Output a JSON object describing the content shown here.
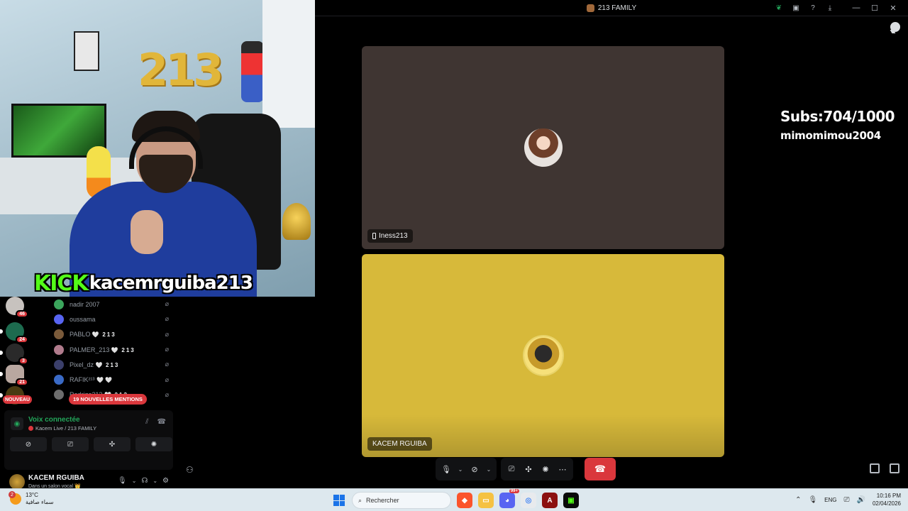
{
  "window": {
    "title": "213 FAMILY"
  },
  "stream": {
    "balloon_text": "213",
    "kick_logo": "KICK",
    "kick_username": "kacemrguiba213"
  },
  "overlay": {
    "subs": "Subs:704/1000",
    "username": "mimomimou2004"
  },
  "tiles": [
    {
      "name": "Iness213",
      "device": "phone-icon",
      "bg": "#3f3532"
    },
    {
      "name": "KACEM RGUIBA",
      "bg": "#d7b93a"
    }
  ],
  "server_rail": [
    {
      "badge": "46"
    },
    {
      "badge": "24"
    },
    {
      "badge": "3"
    },
    {
      "badge": "21"
    },
    {
      "badge": ""
    }
  ],
  "nouveau_label": "NOUVEAU",
  "members": [
    {
      "name": "nadir 2007",
      "hearts": "",
      "tag": ""
    },
    {
      "name": "oussama",
      "hearts": "",
      "tag": ""
    },
    {
      "name": "PABLO",
      "hearts": "🤍",
      "tag": "213"
    },
    {
      "name": "PALMER_213",
      "hearts": "🤍",
      "tag": "213"
    },
    {
      "name": "Pixel_dz",
      "hearts": "🤍",
      "tag": "213"
    },
    {
      "name": "RAFIK²¹³",
      "hearts": "🤍 🤍",
      "tag": ""
    },
    {
      "name": "Rodrigo213",
      "hearts": "🤍",
      "tag": "213"
    }
  ],
  "mentions_pill": "19 NOUVELLES MENTIONS",
  "voice_panel": {
    "status": "Voix connectée",
    "channel": "Kacem Live / 213 FAMILY"
  },
  "user_panel": {
    "name": "KACEM RGUIBA",
    "sub": "Dans un salon vocal 👑"
  },
  "taskbar": {
    "temperature": "13°C",
    "weather_desc": "سماء صافية",
    "weather_badge": "2",
    "search_placeholder": "Rechercher",
    "discord_badge": "99+",
    "language": "ENG",
    "time": "10:16 PM",
    "date": "02/04/2026"
  },
  "colors": {
    "hangup": "#da373c",
    "voice_connected": "#23a55a",
    "kick_green": "#53fc18"
  }
}
